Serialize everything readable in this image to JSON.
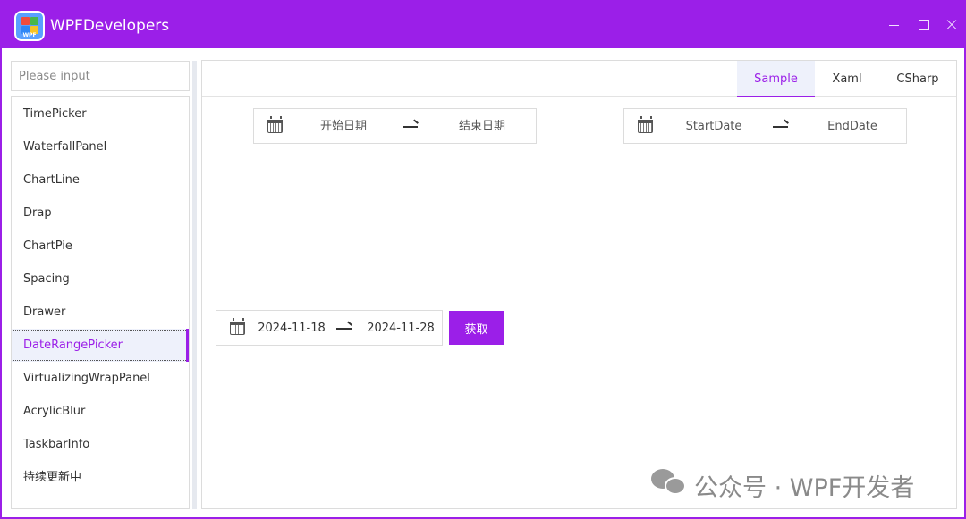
{
  "window": {
    "title": "WPFDevelopers",
    "logo_text": "WPF",
    "accent": "#9b1fe8"
  },
  "search": {
    "placeholder": "Please input",
    "value": ""
  },
  "sidebar": {
    "items": [
      {
        "label": "TimePicker"
      },
      {
        "label": "WaterfallPanel"
      },
      {
        "label": "ChartLine"
      },
      {
        "label": "Drap"
      },
      {
        "label": "ChartPie"
      },
      {
        "label": "Spacing"
      },
      {
        "label": "Drawer"
      },
      {
        "label": "DateRangePicker",
        "selected": true
      },
      {
        "label": "VirtualizingWrapPanel"
      },
      {
        "label": "AcrylicBlur"
      },
      {
        "label": "TaskbarInfo"
      },
      {
        "label": "持续更新中"
      }
    ]
  },
  "tabs": [
    {
      "label": "Sample",
      "active": true
    },
    {
      "label": "Xaml"
    },
    {
      "label": "CSharp"
    }
  ],
  "pickers": {
    "chinese": {
      "start_placeholder": "开始日期",
      "end_placeholder": "结束日期"
    },
    "english": {
      "start_placeholder": "StartDate",
      "end_placeholder": "EndDate"
    },
    "filled": {
      "start": "2024-11-18",
      "end": "2024-11-28"
    }
  },
  "fetch_button": {
    "label": "获取"
  },
  "watermark": {
    "text": "公众号 · WPF开发者"
  },
  "icons": {
    "logo": "wpf-logo-icon",
    "minimize": "minimize-icon",
    "maximize": "maximize-icon",
    "close": "close-icon",
    "calendar": "calendar-icon",
    "arrow": "arrow-right-icon",
    "wechat": "wechat-icon"
  }
}
